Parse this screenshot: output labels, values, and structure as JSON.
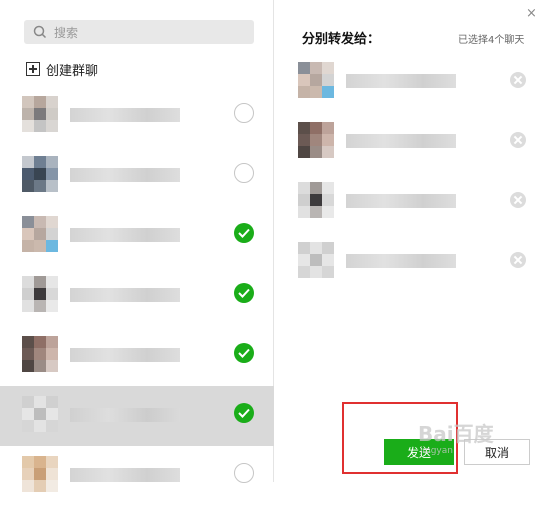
{
  "search": {
    "placeholder": "搜索"
  },
  "create_group_label": "创建群聊",
  "contacts": [
    {
      "checked": false,
      "selected": false,
      "colors": [
        "#d2c6bd",
        "#b7a79d",
        "#d8d2cd",
        "#bdb3ab",
        "#7c7a7c",
        "#cfcbc6",
        "#e4e0dc",
        "#c4c4c4",
        "#d9d6d3"
      ]
    },
    {
      "checked": false,
      "selected": false,
      "colors": [
        "#c4c8ce",
        "#6f7f92",
        "#a9b3be",
        "#4b5a6e",
        "#394552",
        "#8595a8",
        "#4f5a66",
        "#6c7987",
        "#b8c0c8"
      ]
    },
    {
      "checked": true,
      "selected": false,
      "colors": [
        "#8a8f98",
        "#c8b9b2",
        "#e0d7d1",
        "#d9c6bb",
        "#b6a79f",
        "#d3d3d3",
        "#c5b3a7",
        "#cbb9ad",
        "#6cb8e0"
      ]
    },
    {
      "checked": true,
      "selected": false,
      "colors": [
        "#dcdcdc",
        "#a09a97",
        "#e6e6e6",
        "#cfcfcf",
        "#3d3a3c",
        "#d8d8d8",
        "#e1e1e1",
        "#b9b5b3",
        "#e9e9e9"
      ]
    },
    {
      "checked": true,
      "selected": false,
      "colors": [
        "#5c4f4a",
        "#8f6f66",
        "#bda39a",
        "#6c5a55",
        "#a0867d",
        "#cdb5ab",
        "#4f4643",
        "#9a8c86",
        "#d7c9c3"
      ]
    },
    {
      "checked": true,
      "selected": true,
      "colors": [
        "#d0d0d0",
        "#e3e3e3",
        "#d0d0d0",
        "#e6e6e6",
        "#bdbdbd",
        "#e6e6e6",
        "#d6d6d6",
        "#e3e3e3",
        "#d6d6d6"
      ]
    },
    {
      "checked": false,
      "selected": false,
      "colors": [
        "#e3c9aa",
        "#d9b48e",
        "#e9d5bf",
        "#e7d1ba",
        "#c99f77",
        "#efe3d6",
        "#efe4d9",
        "#e4cdb4",
        "#f2ebe3"
      ]
    }
  ],
  "forward_title": "分别转发给：",
  "selected_count_text": "已选择4个聊天",
  "selected_chats": [
    {
      "colors": [
        "#8a8f98",
        "#c8b9b2",
        "#e0d7d1",
        "#d9c6bb",
        "#b6a79f",
        "#d3d3d3",
        "#c5b3a7",
        "#cbb9ad",
        "#6cb8e0"
      ]
    },
    {
      "colors": [
        "#5c4f4a",
        "#8f6f66",
        "#bda39a",
        "#6c5a55",
        "#a0867d",
        "#cdb5ab",
        "#4f4643",
        "#9a8c86",
        "#d7c9c3"
      ]
    },
    {
      "colors": [
        "#dcdcdc",
        "#a09a97",
        "#e6e6e6",
        "#cfcfcf",
        "#3d3a3c",
        "#d8d8d8",
        "#e1e1e1",
        "#b9b5b3",
        "#e9e9e9"
      ]
    },
    {
      "colors": [
        "#d0d0d0",
        "#e3e3e3",
        "#d0d0d0",
        "#e6e6e6",
        "#bdbdbd",
        "#e6e6e6",
        "#d6d6d6",
        "#e3e3e3",
        "#d6d6d6"
      ]
    }
  ],
  "buttons": {
    "send": "发送",
    "cancel": "取消"
  },
  "close_icon": "×",
  "watermark": {
    "main": "Bai百度",
    "sub": "jingyan"
  },
  "accent_color": "#1aad19",
  "annotation_color": "#e03030"
}
